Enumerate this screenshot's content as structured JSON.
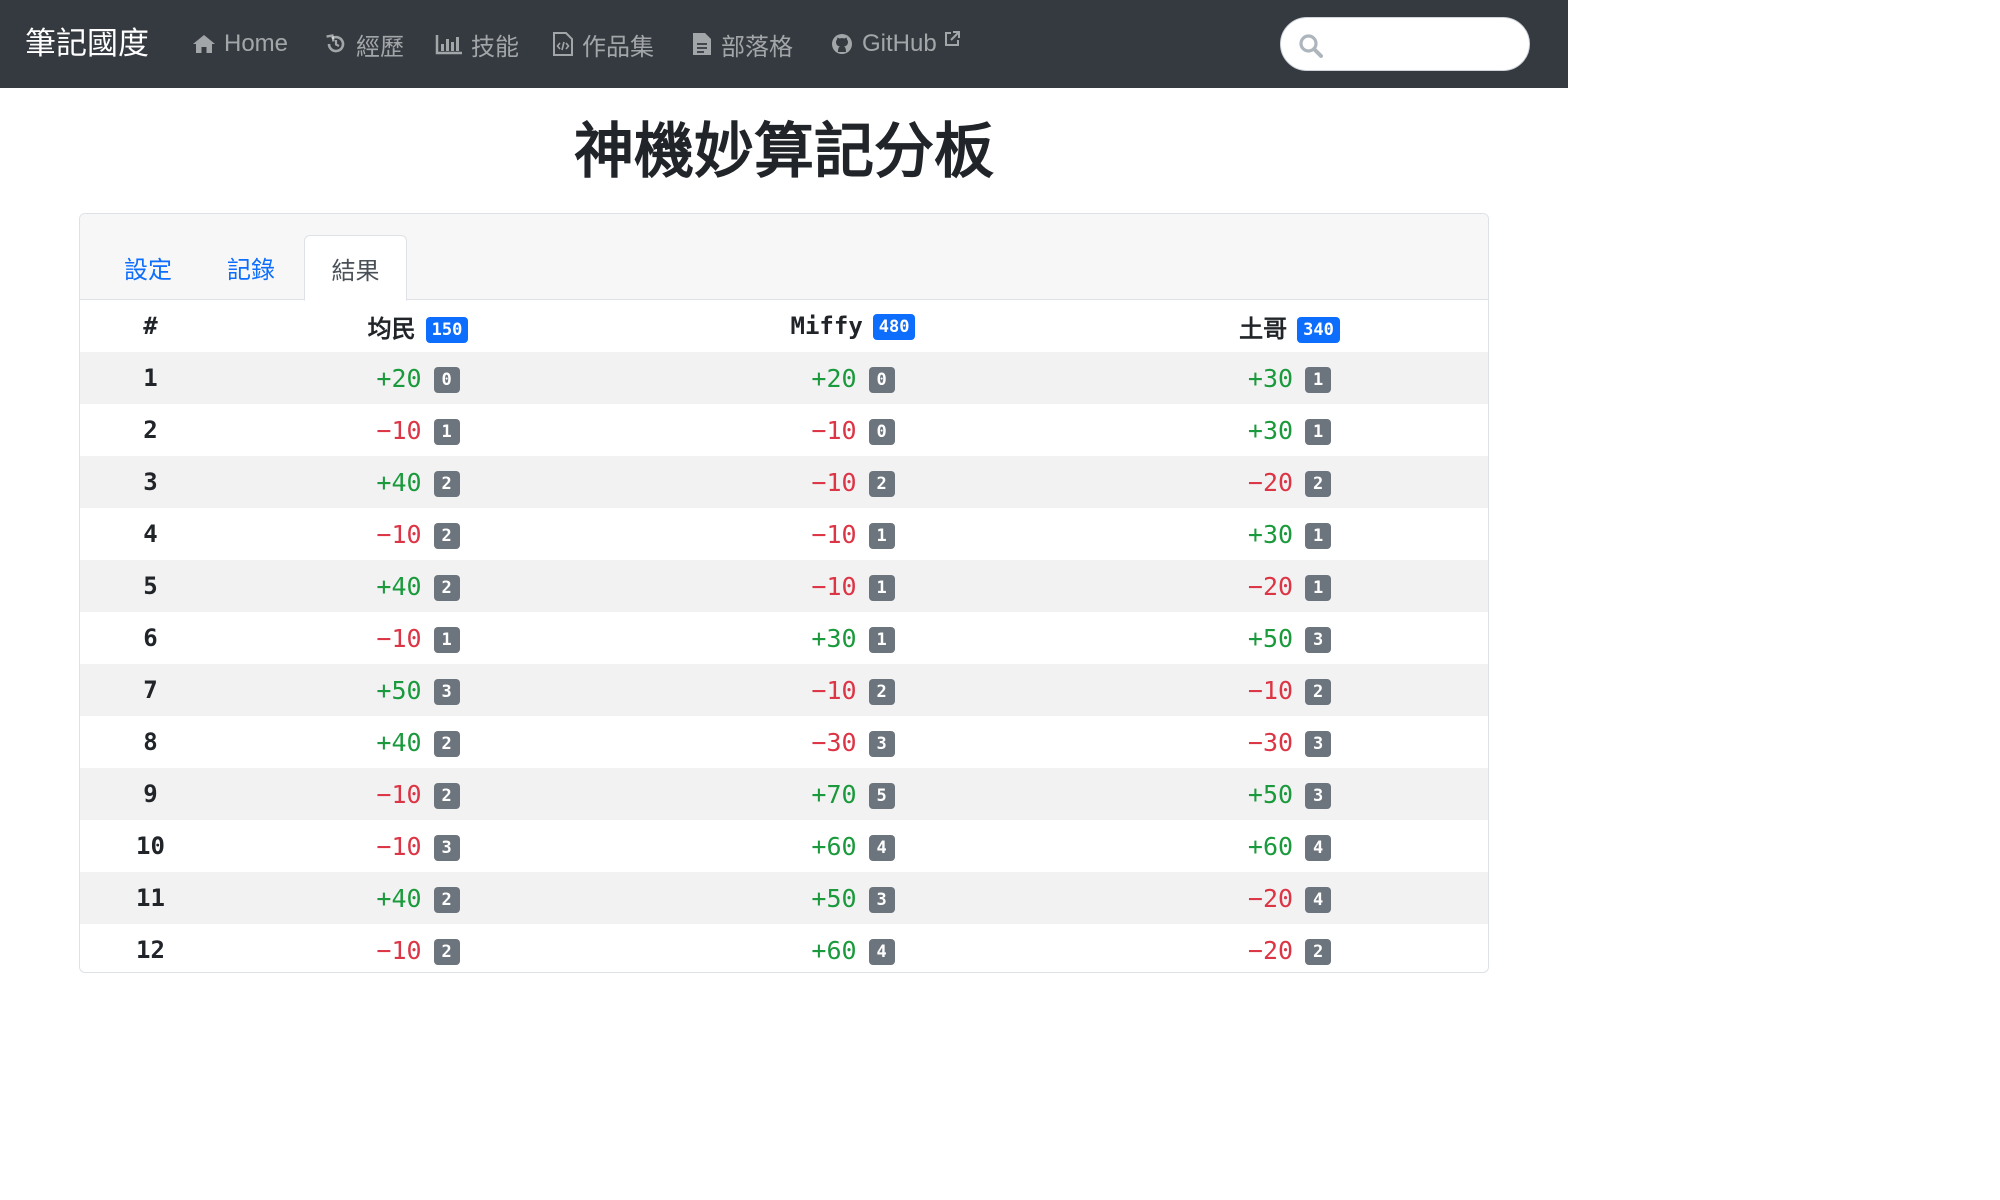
{
  "navbar": {
    "brand": "筆記國度",
    "items": [
      {
        "label": "Home",
        "icon": "home-icon"
      },
      {
        "label": "經歷",
        "icon": "history-icon"
      },
      {
        "label": "技能",
        "icon": "bar-chart-icon"
      },
      {
        "label": "作品集",
        "icon": "code-file-icon"
      },
      {
        "label": "部落格",
        "icon": "document-icon"
      },
      {
        "label": "GitHub",
        "icon": "github-icon",
        "external": true
      }
    ],
    "search": {
      "placeholder": "",
      "value": ""
    }
  },
  "page": {
    "title": "神機妙算記分板"
  },
  "tabs": [
    {
      "label": "設定",
      "active": false
    },
    {
      "label": "記錄",
      "active": false
    },
    {
      "label": "結果",
      "active": true
    }
  ],
  "table": {
    "index_header": "#",
    "players": [
      {
        "name": "均民",
        "total": "150"
      },
      {
        "name": "Miffy",
        "total": "480"
      },
      {
        "name": "土哥",
        "total": "340"
      }
    ],
    "rows": [
      {
        "n": "1",
        "cells": [
          {
            "score": "+20",
            "badge": "0"
          },
          {
            "score": "+20",
            "badge": "0"
          },
          {
            "score": "+30",
            "badge": "1"
          }
        ]
      },
      {
        "n": "2",
        "cells": [
          {
            "score": "−10",
            "badge": "1"
          },
          {
            "score": "−10",
            "badge": "0"
          },
          {
            "score": "+30",
            "badge": "1"
          }
        ]
      },
      {
        "n": "3",
        "cells": [
          {
            "score": "+40",
            "badge": "2"
          },
          {
            "score": "−10",
            "badge": "2"
          },
          {
            "score": "−20",
            "badge": "2"
          }
        ]
      },
      {
        "n": "4",
        "cells": [
          {
            "score": "−10",
            "badge": "2"
          },
          {
            "score": "−10",
            "badge": "1"
          },
          {
            "score": "+30",
            "badge": "1"
          }
        ]
      },
      {
        "n": "5",
        "cells": [
          {
            "score": "+40",
            "badge": "2"
          },
          {
            "score": "−10",
            "badge": "1"
          },
          {
            "score": "−20",
            "badge": "1"
          }
        ]
      },
      {
        "n": "6",
        "cells": [
          {
            "score": "−10",
            "badge": "1"
          },
          {
            "score": "+30",
            "badge": "1"
          },
          {
            "score": "+50",
            "badge": "3"
          }
        ]
      },
      {
        "n": "7",
        "cells": [
          {
            "score": "+50",
            "badge": "3"
          },
          {
            "score": "−10",
            "badge": "2"
          },
          {
            "score": "−10",
            "badge": "2"
          }
        ]
      },
      {
        "n": "8",
        "cells": [
          {
            "score": "+40",
            "badge": "2"
          },
          {
            "score": "−30",
            "badge": "3"
          },
          {
            "score": "−30",
            "badge": "3"
          }
        ]
      },
      {
        "n": "9",
        "cells": [
          {
            "score": "−10",
            "badge": "2"
          },
          {
            "score": "+70",
            "badge": "5"
          },
          {
            "score": "+50",
            "badge": "3"
          }
        ]
      },
      {
        "n": "10",
        "cells": [
          {
            "score": "−10",
            "badge": "3"
          },
          {
            "score": "+60",
            "badge": "4"
          },
          {
            "score": "+60",
            "badge": "4"
          }
        ]
      },
      {
        "n": "11",
        "cells": [
          {
            "score": "+40",
            "badge": "2"
          },
          {
            "score": "+50",
            "badge": "3"
          },
          {
            "score": "−20",
            "badge": "4"
          }
        ]
      },
      {
        "n": "12",
        "cells": [
          {
            "score": "−10",
            "badge": "2"
          },
          {
            "score": "+60",
            "badge": "4"
          },
          {
            "score": "−20",
            "badge": "2"
          }
        ]
      }
    ]
  },
  "colors": {
    "navbar_bg": "#343a40",
    "positive": "#1a9a3c",
    "negative": "#dc3545",
    "total_badge": "#0d6efd",
    "round_badge": "#6c757d",
    "link": "#0d6efd"
  }
}
